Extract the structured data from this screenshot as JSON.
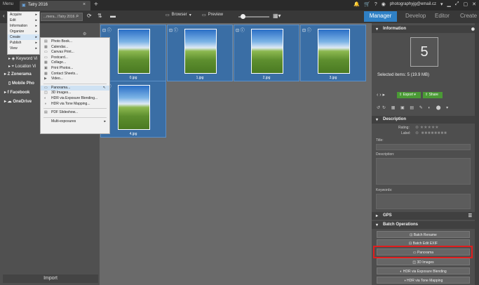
{
  "titlebar": {
    "menu_label": "Menu",
    "tab_label": "Tatry 2016",
    "close_glyph": "×",
    "plus_glyph": "+",
    "user_email": "photographyjg@email.cz",
    "icons": [
      "bell-icon",
      "cart-icon",
      "question-icon",
      "user-icon",
      "minimize-icon",
      "fullscreen-icon",
      "maximize-icon",
      "close-icon"
    ]
  },
  "toolbar": {
    "path_value": "...mera...\\Tatry 2016",
    "browser_label": "Browser",
    "preview_label": "Preview",
    "mode_tabs": [
      "Manager",
      "Develop",
      "Editor",
      "Create"
    ]
  },
  "menu": {
    "level1": [
      {
        "label": "Acquire",
        "arrow": true
      },
      {
        "label": "Edit",
        "arrow": true
      },
      {
        "label": "Information",
        "arrow": true
      },
      {
        "label": "Organize",
        "arrow": true
      },
      {
        "label": "Create",
        "arrow": true,
        "highlight": true
      },
      {
        "label": "Publish",
        "arrow": true
      },
      {
        "label": "View",
        "arrow": true
      }
    ],
    "level2": [
      {
        "label": "Photo Book...",
        "icon": "book-icon"
      },
      {
        "label": "Calendar...",
        "icon": "calendar-icon"
      },
      {
        "label": "Canvas Print...",
        "icon": "canvas-icon"
      },
      {
        "label": "Postcard...",
        "icon": "postcard-icon"
      },
      {
        "label": "Collage...",
        "icon": "collage-icon"
      },
      {
        "label": "Print Photos...",
        "icon": "print-icon"
      },
      {
        "label": "Contact Sheets...",
        "icon": "contact-sheet-icon"
      },
      {
        "label": "Video...",
        "icon": "video-icon"
      },
      {
        "sep": true
      },
      {
        "label": "Panorama...",
        "icon": "panorama-icon",
        "highlight": true
      },
      {
        "label": "3D Images...",
        "icon": "3d-icon"
      },
      {
        "label": "HDR via Exposure Blending...",
        "icon": "hdr-icon"
      },
      {
        "label": "HDR via Tone Mapping...",
        "icon": "hdr-tone-icon"
      },
      {
        "sep": true
      },
      {
        "label": "PDF Slideshow...",
        "icon": "pdf-icon"
      },
      {
        "sep": true
      },
      {
        "label": "Multi-exposures",
        "icon": "",
        "arrow": true
      }
    ]
  },
  "leftpanel": {
    "tree": [
      "Keyword Vi",
      "Location Vi",
      "Zonerama",
      "Mobile Pho",
      "Facebook",
      "OneDrive"
    ],
    "import_label": "Import"
  },
  "thumbnails": [
    {
      "name": "0.jpg"
    },
    {
      "name": "1.jpg"
    },
    {
      "name": "2.jpg"
    },
    {
      "name": "3.jpg"
    },
    {
      "name": "4.jpg"
    }
  ],
  "rightpanel": {
    "information_title": "Information",
    "selected_count": "5",
    "selected_items": "Selected items: 5 (19.9 MB)",
    "export_label": "Export",
    "share_label": "Share",
    "description_title": "Description",
    "rating_label": "Rating:",
    "label_label": "Label:",
    "title_label": "Title:",
    "description_label": "Description:",
    "keywords_label": "Keywords:",
    "gps_title": "GPS",
    "batch_title": "Batch Operations",
    "batch_ops": [
      "Batch Rename",
      "Batch Edit EXIF",
      "Panorama",
      "3D Images",
      "HDR via Exposure Blending",
      "HDR via Tone Mapping"
    ]
  },
  "colors": {
    "accent": "#2f80c5",
    "share_green": "#4a9a35",
    "highlight_red": "#e01e1e",
    "selection_blue": "#3a6ea5"
  }
}
